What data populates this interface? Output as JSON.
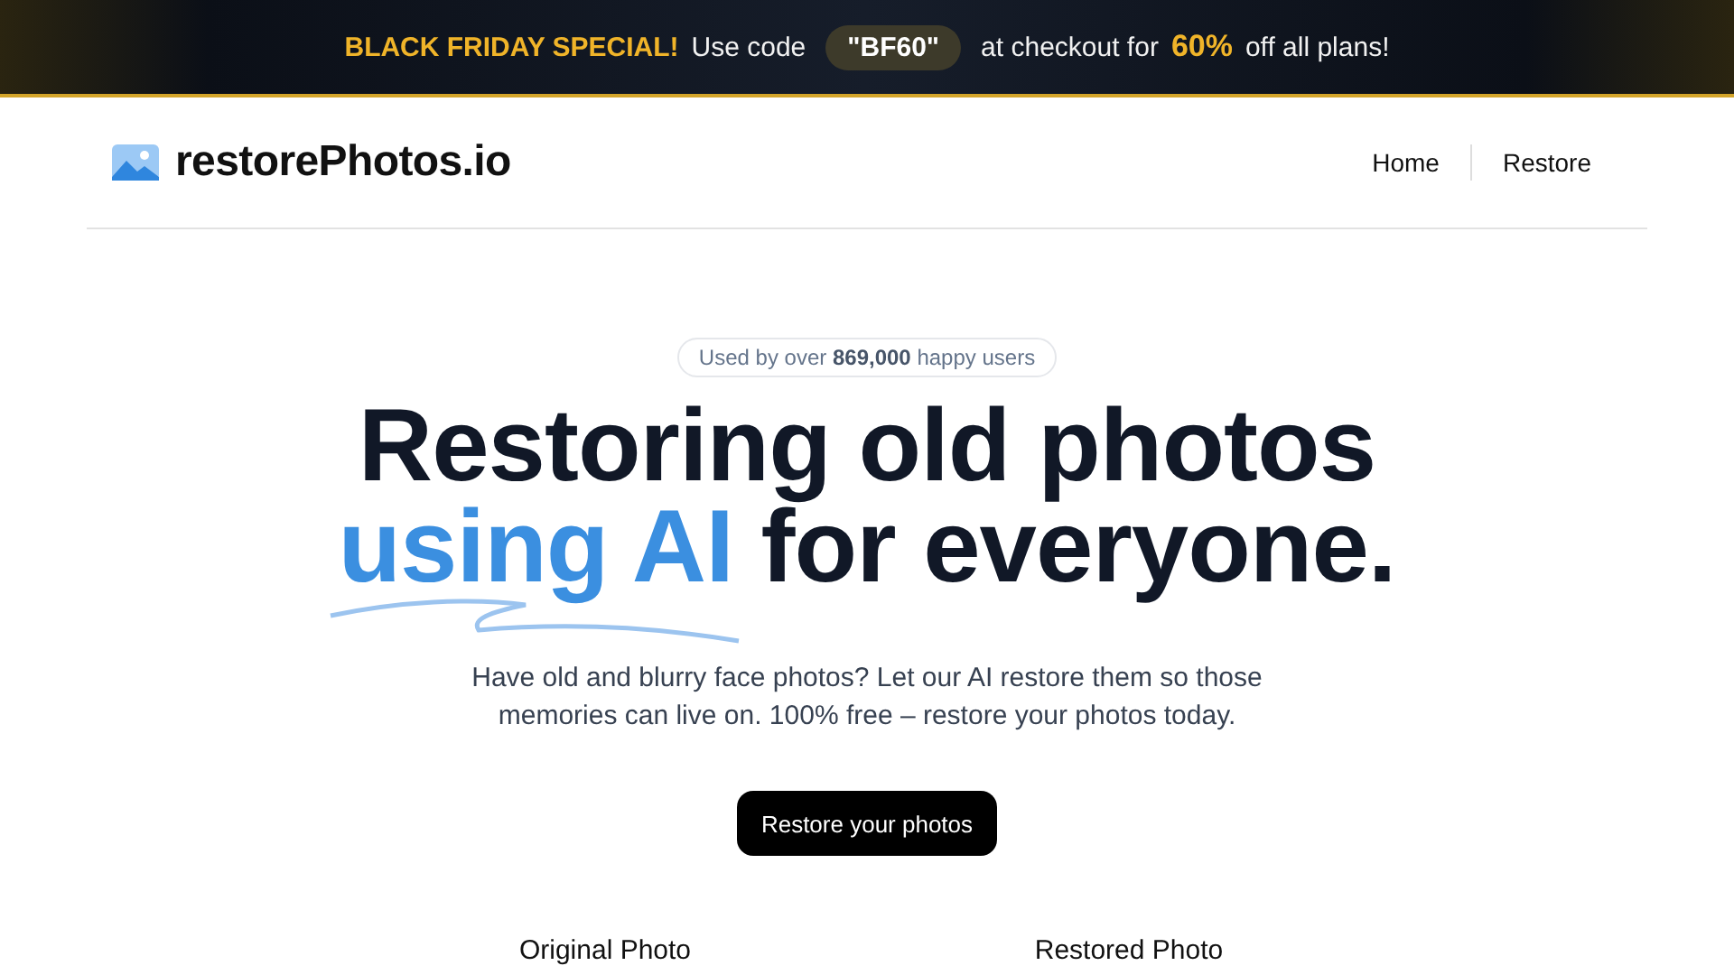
{
  "banner": {
    "segments": [
      {
        "kind": "accent",
        "text": "BLACK FRIDAY SPECIAL!"
      },
      {
        "kind": "plain",
        "text": "Use code"
      },
      {
        "kind": "code",
        "text": "\"BF60\""
      },
      {
        "kind": "plain",
        "text": "at checkout for"
      },
      {
        "kind": "highlight",
        "text": "60%"
      },
      {
        "kind": "plain",
        "text": "off all plans!"
      }
    ]
  },
  "header": {
    "logo": "restorePhotos.io",
    "nav": [
      {
        "label": "Home"
      },
      {
        "label": "Restore"
      }
    ]
  },
  "hero": {
    "badge": "Used by over **869,000** happy users",
    "title_line_1": "Restoring old photos",
    "title_highlight": "using AI",
    "title_rest": "for everyone.",
    "description": "Have old and blurry face photos? Let our AI restore them so those memories can live on. 100% free – restore your photos today.",
    "cta": "Restore your photos"
  },
  "comparison": {
    "labels": [
      "Original Photo",
      "Restored Photo"
    ]
  }
}
